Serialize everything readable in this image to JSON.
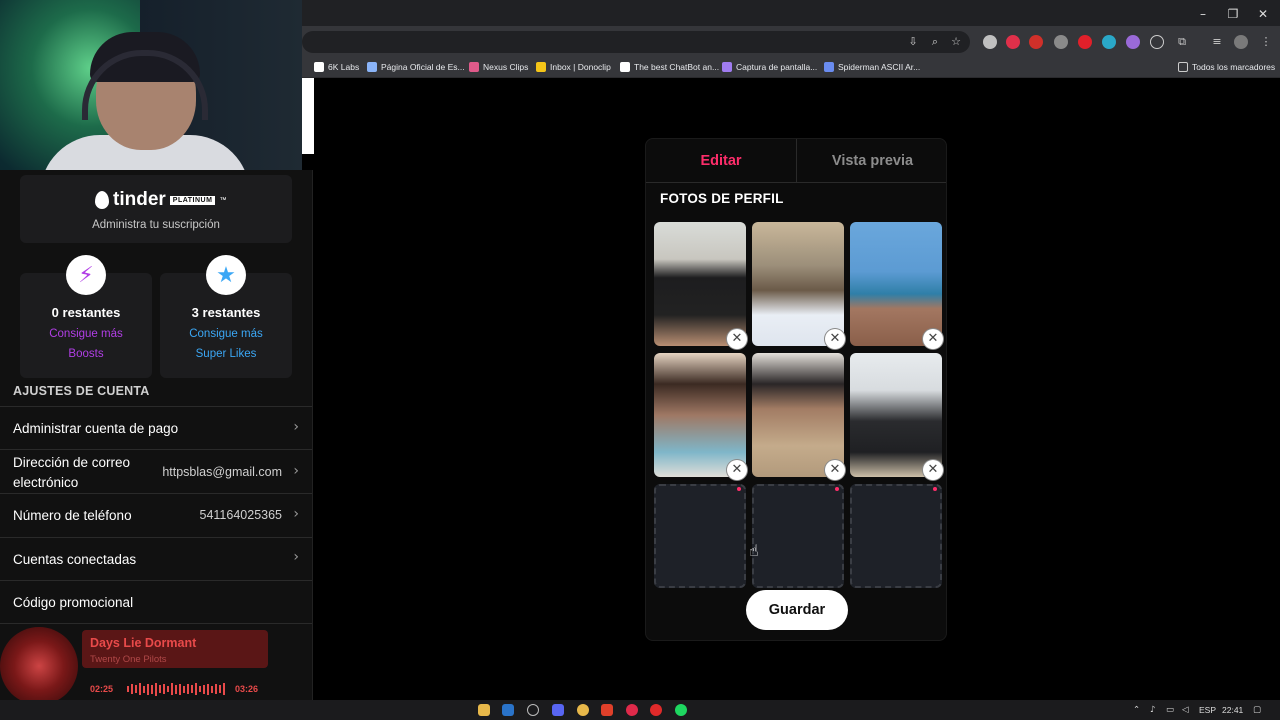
{
  "browser": {
    "window_controls": {
      "minimize": "–",
      "maximize": "❐",
      "close": "✕"
    },
    "toolbar_icons": [
      "install-icon",
      "zoom-icon",
      "star-icon"
    ],
    "bookmarks": [
      {
        "label": "6K Labs",
        "color": "#ffffff"
      },
      {
        "label": "Página Oficial de Es...",
        "color": "#8ab4f8"
      },
      {
        "label": "Nexus Clips",
        "color": "#e05a8a"
      },
      {
        "label": "Inbox | Donoclip",
        "color": "#f5c518"
      },
      {
        "label": "The best ChatBot an...",
        "color": "#ffffff"
      },
      {
        "label": "Captura de pantalla...",
        "color": "#a07cf0"
      },
      {
        "label": "Spiderman ASCII Ar...",
        "color": "#6a8cf0"
      }
    ],
    "all_bookmarks": "Todos los marcadores"
  },
  "sidebar": {
    "brand": {
      "name": "tinder",
      "badge": "PLATINUM",
      "tm": "™"
    },
    "manage_subscription": "Administra tu suscripción",
    "boosts": {
      "count": "0 restantes",
      "link_line1": "Consigue más",
      "link_line2": "Boosts",
      "icon": "lightning-icon",
      "color": "#b13ee6"
    },
    "superlikes": {
      "count": "3 restantes",
      "link_line1": "Consigue más",
      "link_line2": "Super Likes",
      "icon": "star-icon",
      "color": "#3ba7f5"
    },
    "section_title": "AJUSTES DE CUENTA",
    "settings": [
      {
        "label": "Administrar cuenta de pago",
        "value": ""
      },
      {
        "label": "Dirección de correo",
        "label2": "electrónico",
        "value": "httpsblas@gmail.com"
      },
      {
        "label": "Número de teléfono",
        "value": "541164025365"
      },
      {
        "label": "Cuentas conectadas",
        "value": ""
      },
      {
        "label": "Código promocional",
        "value": ""
      }
    ]
  },
  "music": {
    "title": "Days Lie Dormant",
    "artist": "Twenty One Pilots",
    "elapsed": "02:25",
    "duration": "03:26"
  },
  "editor": {
    "tabs": [
      {
        "label": "Editar",
        "active": true
      },
      {
        "label": "Vista previa",
        "active": false
      }
    ],
    "photos_heading": "FOTOS DE PERFIL",
    "photos_filled": 6,
    "photos_empty": 3,
    "save_label": "Guardar",
    "accent": "#fd2d6a"
  },
  "taskbar": {
    "language": "ESP",
    "time": "22:41"
  }
}
